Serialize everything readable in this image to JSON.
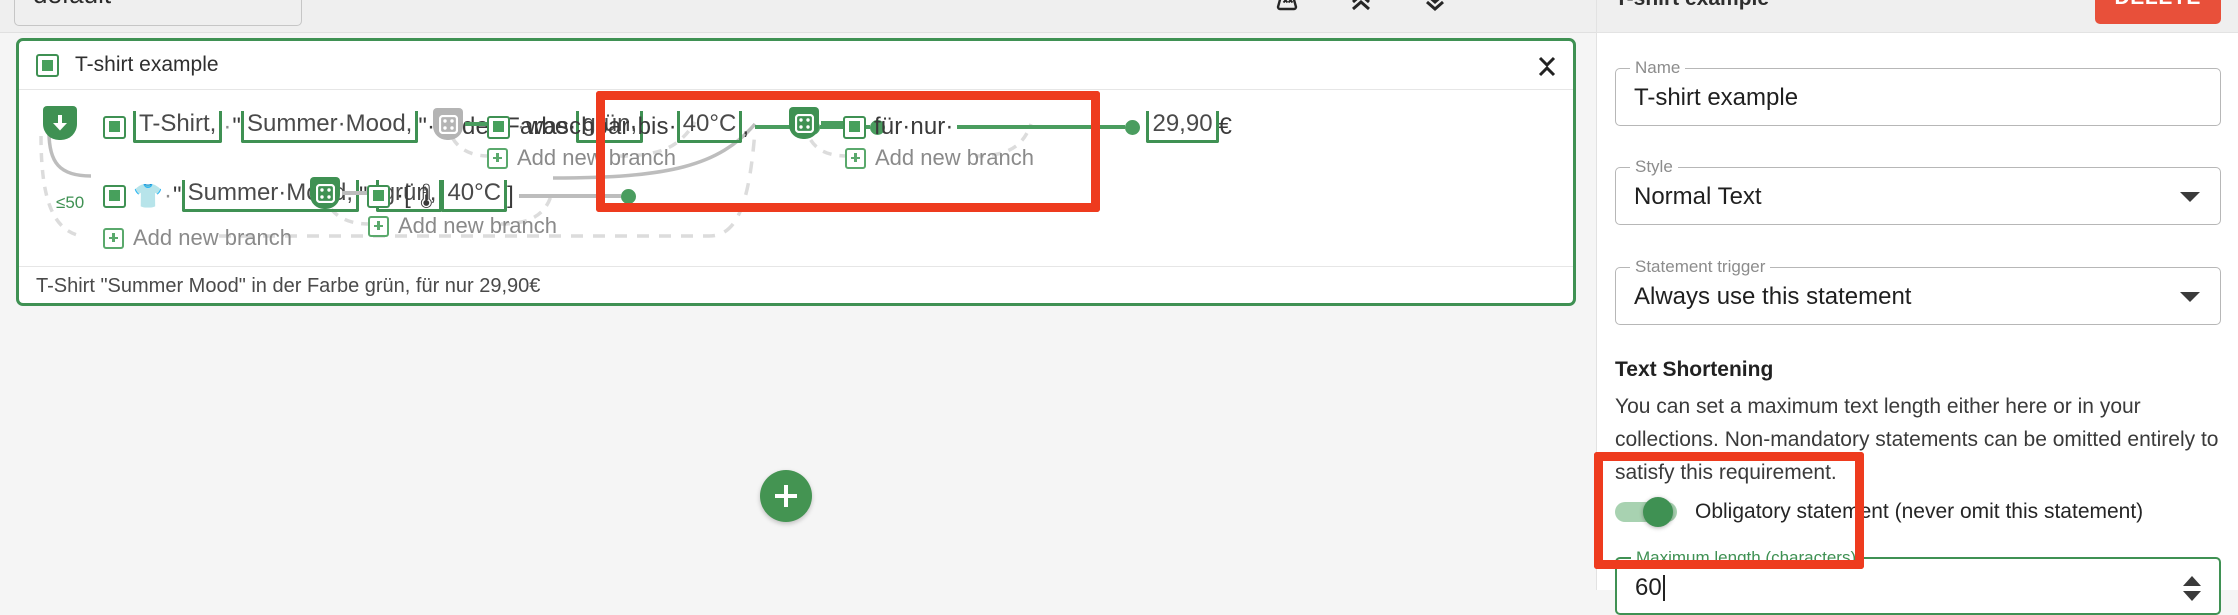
{
  "topbar": {
    "collection_select": {
      "value": "default",
      "caret_icon": "chevron-down-icon"
    },
    "icons": [
      {
        "name": "collapse-all-icon",
        "glyph": "collapse-group-icon"
      },
      {
        "name": "expand-up-icon",
        "glyph": "double-chevron-up-icon"
      },
      {
        "name": "collapse-down-icon",
        "glyph": "double-chevron-down-icon"
      }
    ]
  },
  "card": {
    "title": "T-shirt example",
    "statement_icon": "filled-square-icon",
    "collapse_icon": "expand-collapse-chevrons-icon",
    "preview_text": "T-Shirt \"Summer Mood\" in der Farbe grün, für nur 29,90€",
    "start_badge": {
      "icon": "arrow-down-icon",
      "limit_label": "≤50"
    },
    "add_statement_button": {
      "icon": "plus-icon"
    }
  },
  "flow": {
    "branch_1": {
      "tokens": [
        {
          "type": "text",
          "value": "T-Shirt,"
        },
        {
          "type": "sep",
          "value": "·"
        },
        {
          "type": "text",
          "value": "\""
        },
        {
          "type": "slot",
          "value": "Summer·Mood,"
        },
        {
          "type": "text",
          "value": "\"·in·der·Farbe·"
        },
        {
          "type": "slot",
          "value": "grün,"
        }
      ],
      "plain": "T-Shirt,·\"Summer·Mood,\"·in·der·Farbe·grün,"
    },
    "branch_1_segment_2": {
      "dice_icon": "dice-branch-icon-inactive",
      "tokens": [
        {
          "type": "sep",
          "value": "·"
        },
        {
          "type": "text",
          "value": "waschbar·bis·"
        },
        {
          "type": "slot",
          "value": "40°C"
        },
        {
          "type": "text",
          "value": ","
        }
      ],
      "plain": "·waschbar·bis·40°C,",
      "add_branch_label": "Add new branch"
    },
    "branch_1_segment_3": {
      "dice_icon": "dice-branch-icon-active",
      "tokens": [
        {
          "type": "text",
          "value": "für·nur·"
        }
      ],
      "plain": "für·nur·",
      "price_slot": "29,90",
      "currency": "€",
      "add_branch_label": "Add new branch"
    },
    "branch_2": {
      "shirt_emoji": "👕",
      "tokens": [
        {
          "type": "sep",
          "value": "·"
        },
        {
          "type": "text",
          "value": "\""
        },
        {
          "type": "slot",
          "value": "Summer·Mood,"
        },
        {
          "type": "text",
          "value": "\"·"
        },
        {
          "type": "slot",
          "value": "grün,"
        }
      ],
      "plain": "·\"Summer·Mood,\"·grün,",
      "dice_icon": "dice-branch-icon-active",
      "temp_tokens": {
        "open": "·[",
        "emoji": "🌡",
        "slot": "40°C",
        "close": "]"
      },
      "add_branch_label": "Add new branch"
    },
    "branch_3": {
      "add_branch_label": "Add new branch"
    }
  },
  "panel": {
    "title": "T-shirt example",
    "delete_label": "DELETE",
    "name_field": {
      "label": "Name",
      "value": "T-shirt example"
    },
    "style_field": {
      "label": "Style",
      "value": "Normal Text",
      "caret_icon": "chevron-down-icon"
    },
    "trigger_field": {
      "label": "Statement trigger",
      "value": "Always use this statement",
      "caret_icon": "chevron-down-icon"
    },
    "shortening": {
      "heading": "Text Shortening",
      "body": "You can set a maximum text length either here or in your collections. Non-mandatory statements can be omitted entirely to satisfy this requirement."
    },
    "obligatory_toggle": {
      "label": "Obligatory statement (never omit this statement)",
      "state": "on"
    },
    "max_length_field": {
      "label": "Maximum length (characters)",
      "value": "60",
      "stepper_icon": "number-stepper-icon"
    }
  },
  "annotations": {
    "color": "#ee3b1e",
    "boxes": [
      {
        "name": "annotation-flow-segment"
      },
      {
        "name": "annotation-max-length"
      }
    ]
  }
}
